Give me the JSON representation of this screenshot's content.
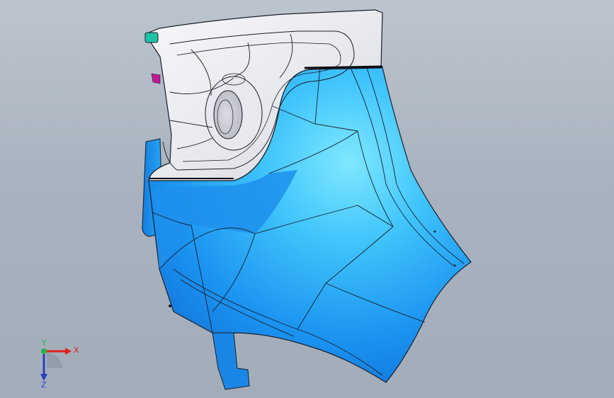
{
  "viewport": {
    "background_top": "#bcc4cd",
    "background_bottom": "#a3adba"
  },
  "model": {
    "part_color": "#1c9ef5",
    "part_highlight": "#6fe4ff",
    "flange_color": "#f2f3f6",
    "edge_color": "#1a1e2a"
  },
  "triad": {
    "x_label": "X",
    "y_label": "Y",
    "z_label": "Z",
    "x_color": "#e01e1e",
    "y_color": "#23b34a",
    "z_color": "#2a3ec8"
  }
}
